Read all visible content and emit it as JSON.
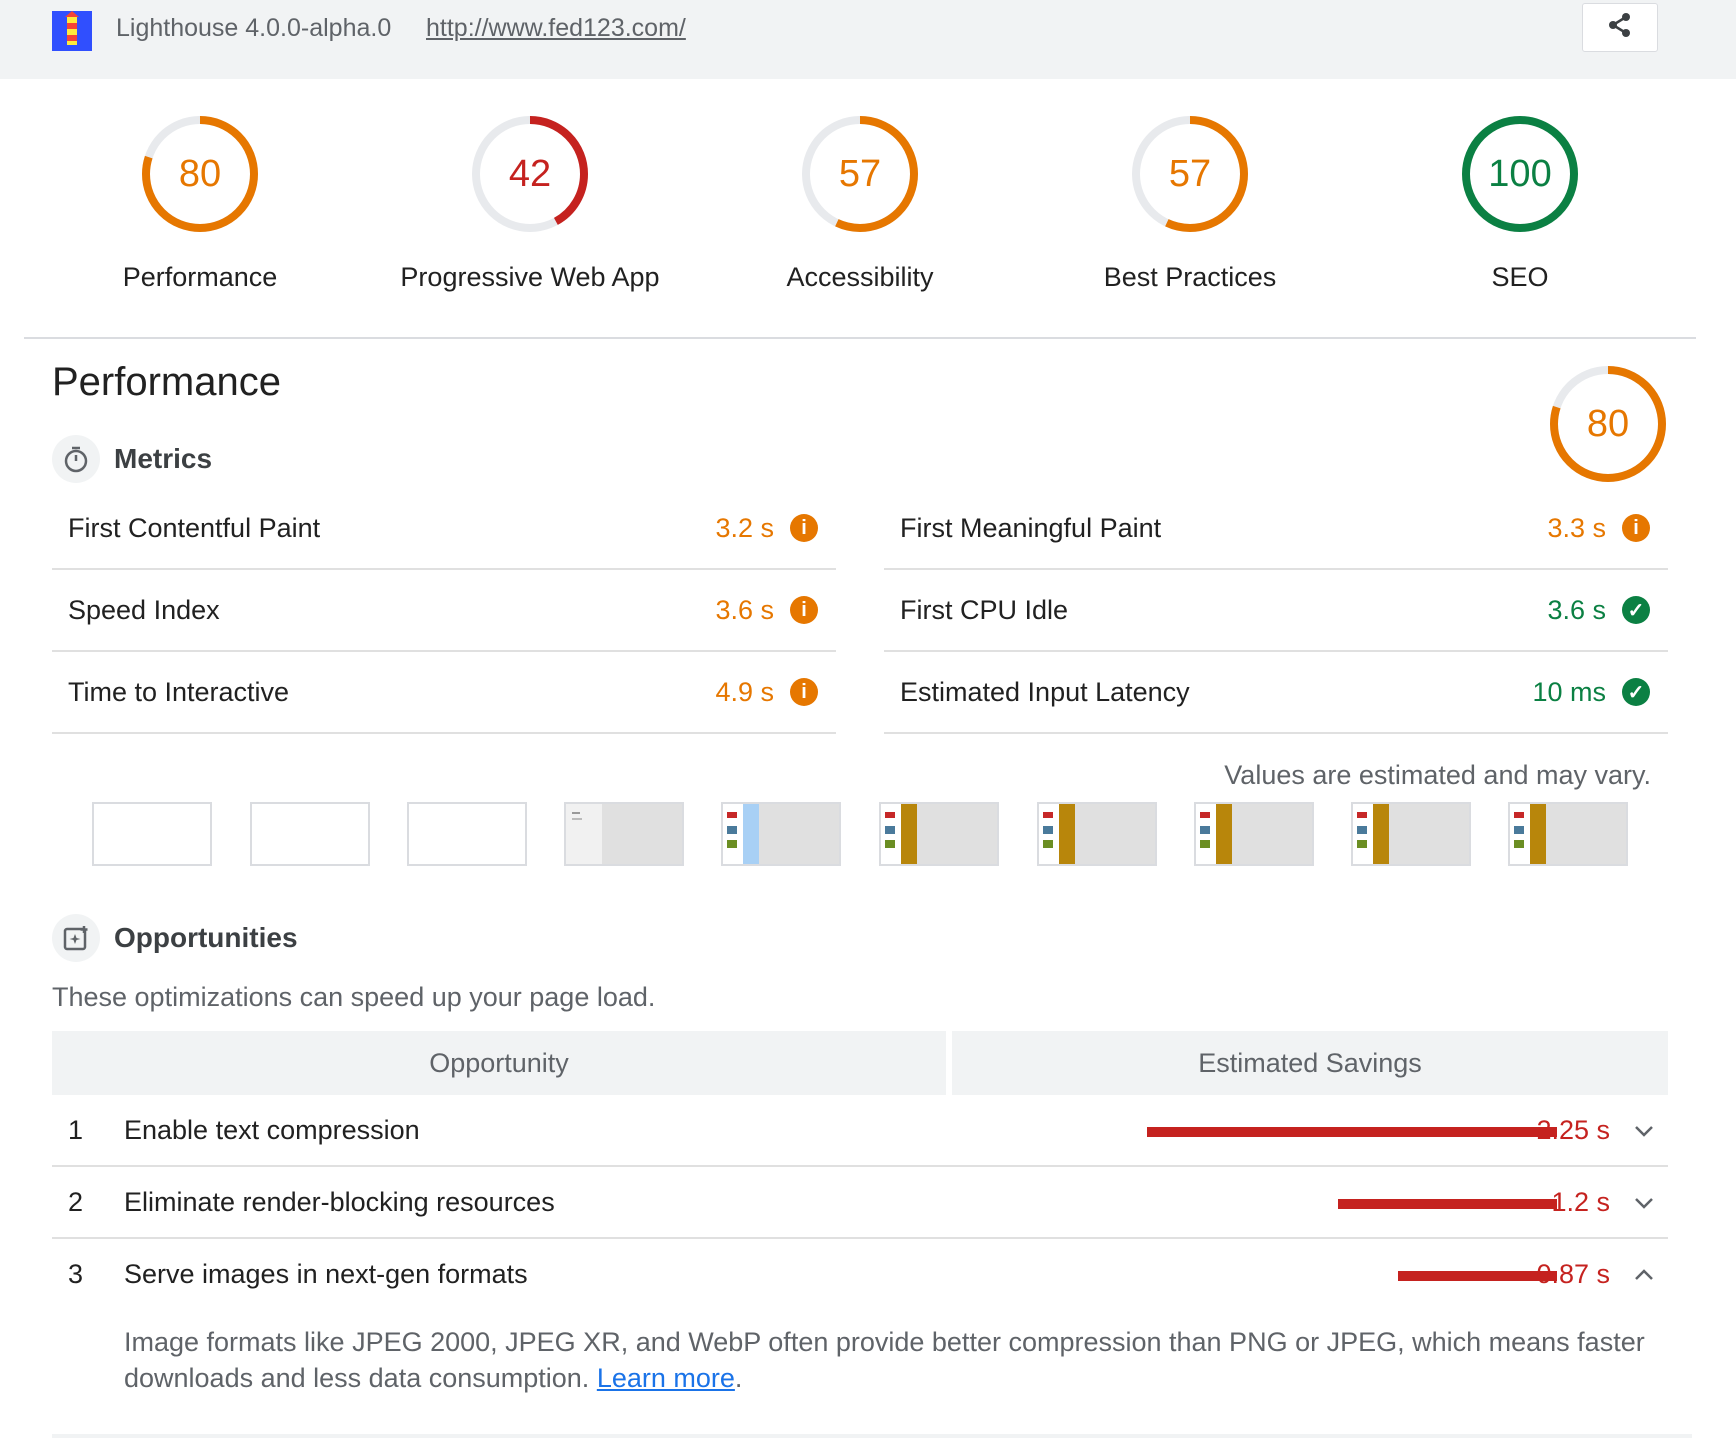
{
  "header": {
    "version": "Lighthouse 4.0.0-alpha.0",
    "url": "http://www.fed123.com/",
    "share_icon": "share-icon"
  },
  "colors": {
    "pass": "#0cce6b",
    "average": "#e67700",
    "fail": "#c5221f",
    "pass_text": "#0b8043"
  },
  "gauges": [
    {
      "label": "Performance",
      "score": "80",
      "fraction": 0.8,
      "rating": "average"
    },
    {
      "label": "Progressive Web App",
      "score": "42",
      "fraction": 0.42,
      "rating": "fail"
    },
    {
      "label": "Accessibility",
      "score": "57",
      "fraction": 0.57,
      "rating": "average"
    },
    {
      "label": "Best Practices",
      "score": "57",
      "fraction": 0.57,
      "rating": "average"
    },
    {
      "label": "SEO",
      "score": "100",
      "fraction": 1.0,
      "rating": "pass"
    }
  ],
  "performance": {
    "title": "Performance",
    "score": "80",
    "fraction": 0.8,
    "metrics_title": "Metrics",
    "metrics_icon": "stopwatch-icon",
    "metrics": [
      {
        "title": "First Contentful Paint",
        "value": "3.2 s",
        "rating": "average",
        "icon": "info-icon"
      },
      {
        "title": "First Meaningful Paint",
        "value": "3.3 s",
        "rating": "average",
        "icon": "info-icon"
      },
      {
        "title": "Speed Index",
        "value": "3.6 s",
        "rating": "average",
        "icon": "info-icon"
      },
      {
        "title": "First CPU Idle",
        "value": "3.6 s",
        "rating": "pass",
        "icon": "check-icon"
      },
      {
        "title": "Time to Interactive",
        "value": "4.9 s",
        "rating": "average",
        "icon": "info-icon"
      },
      {
        "title": "Estimated Input Latency",
        "value": "10 ms",
        "rating": "pass",
        "icon": "check-icon"
      }
    ],
    "estimate_note": "Values are estimated and may vary.",
    "opportunities_title": "Opportunities",
    "opportunities_icon": "opportunity-icon",
    "opportunities_desc": "These optimizations can speed up your page load.",
    "table_headers": {
      "opportunity": "Opportunity",
      "savings": "Estimated Savings"
    },
    "opportunities": [
      {
        "index": "1",
        "title": "Enable text compression",
        "savings": "2.25 s",
        "savings_value": 2.25,
        "expanded": false
      },
      {
        "index": "2",
        "title": "Eliminate render-blocking resources",
        "savings": "1.2 s",
        "savings_value": 1.2,
        "expanded": false
      },
      {
        "index": "3",
        "title": "Serve images in next-gen formats",
        "savings": "0.87 s",
        "savings_value": 0.87,
        "expanded": true
      }
    ],
    "detail": {
      "text": "Image formats like JPEG 2000, JPEG XR, and WebP often provide better compression than PNG or JPEG, which means faster downloads and less data consumption. ",
      "link": "Learn more",
      "tail": "."
    }
  }
}
